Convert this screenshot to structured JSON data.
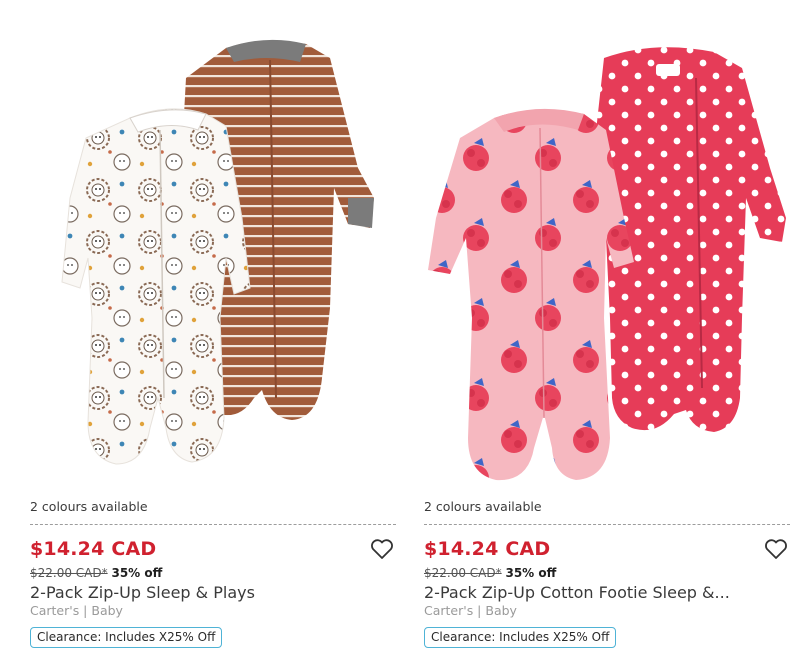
{
  "products": [
    {
      "image_alt": "2-Pack Zip-Up Sleep & Plays",
      "colours": "2 colours available",
      "price": "$14.24 CAD",
      "was_price": "$22.00 CAD*",
      "discount": "35% off",
      "title": "2-Pack Zip-Up Sleep & Plays",
      "brand": "Carter's | Baby",
      "badge": "Clearance: Includes X25% Off",
      "icons": [
        "heart-outline-icon"
      ]
    },
    {
      "image_alt": "2-Pack Zip-Up Cotton Footie Sleep & Play",
      "colours": "2 colours available",
      "price": "$14.24 CAD",
      "was_price": "$22.00 CAD*",
      "discount": "35% off",
      "title": "2-Pack Zip-Up Cotton Footie Sleep &...",
      "brand": "Carter's | Baby",
      "badge": "Clearance: Includes X25% Off",
      "icons": [
        "heart-outline-icon"
      ]
    }
  ],
  "colors": {
    "sale_price": "#d0212f",
    "badge_border": "#4fb3d6",
    "brand_text": "#9a9a9a"
  }
}
